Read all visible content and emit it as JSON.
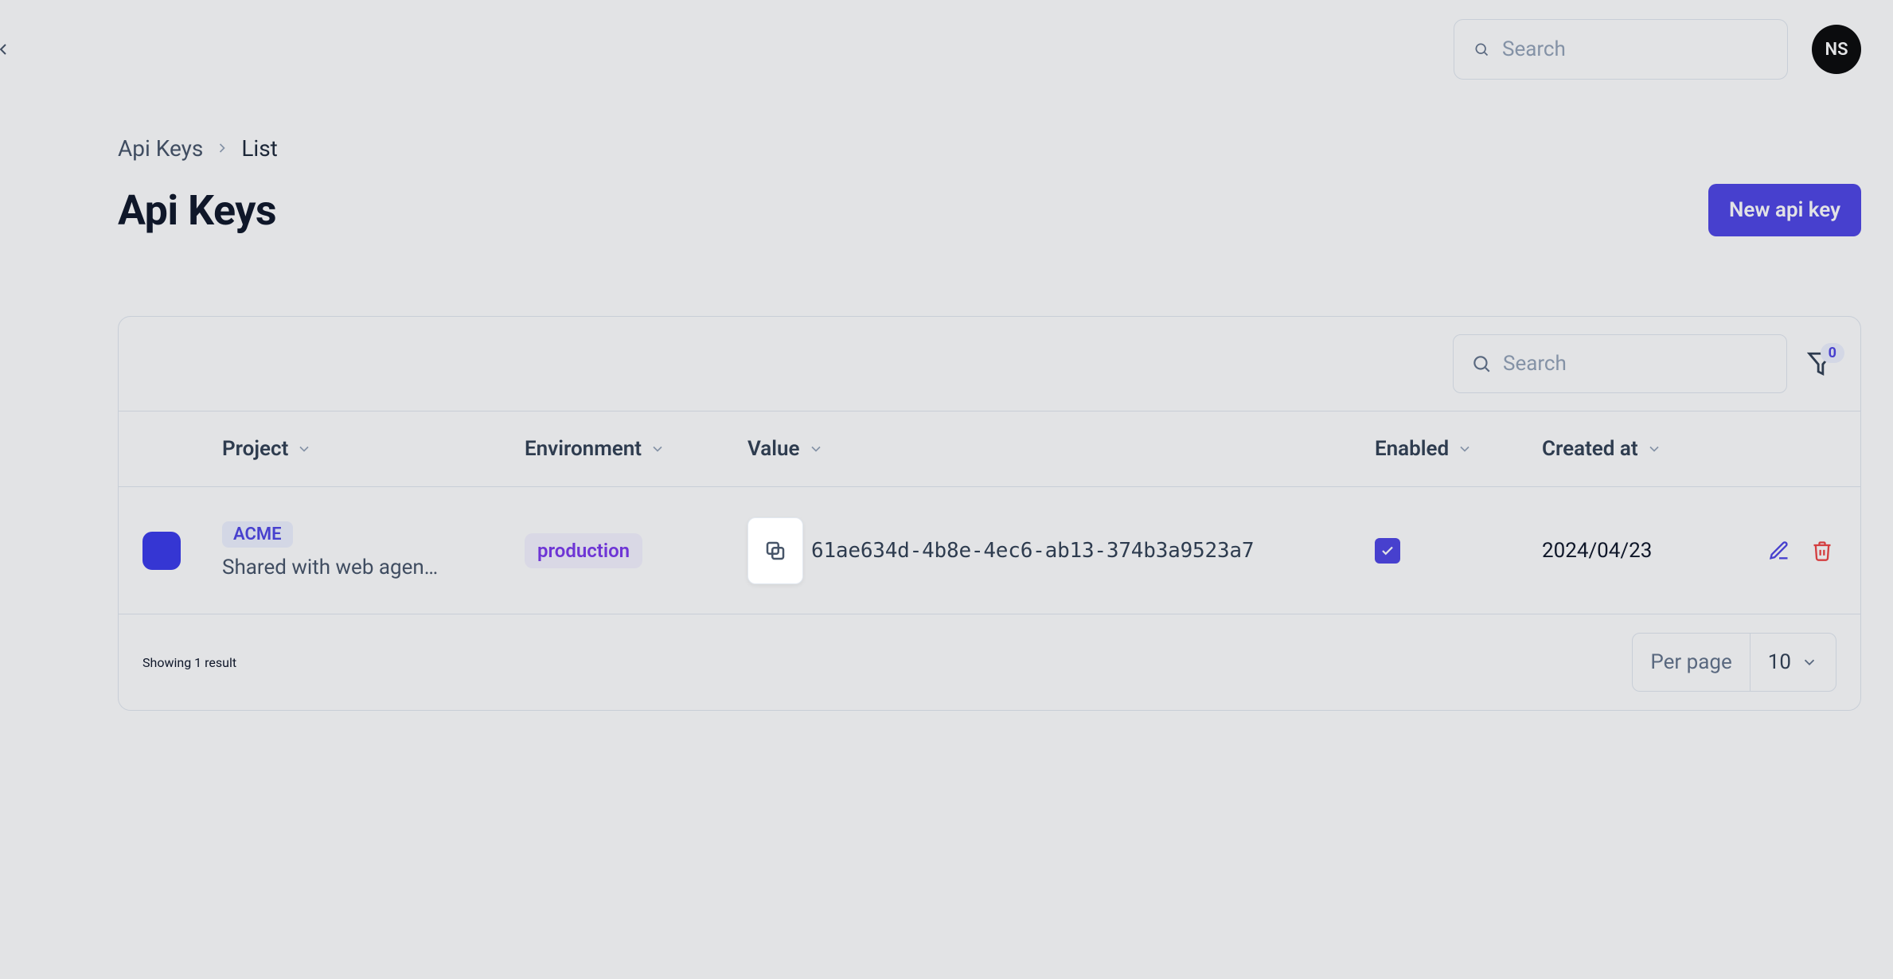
{
  "header": {
    "search_placeholder": "Search",
    "avatar_initials": "NS"
  },
  "breadcrumb": {
    "root": "Api Keys",
    "current": "List"
  },
  "page": {
    "title": "Api Keys",
    "new_button": "New api key"
  },
  "table": {
    "search_placeholder": "Search",
    "filter_count": "0",
    "columns": {
      "project": "Project",
      "environment": "Environment",
      "value": "Value",
      "enabled": "Enabled",
      "created_at": "Created at"
    },
    "rows": [
      {
        "project_name": "ACME",
        "project_subtitle": "Shared with web agen…",
        "environment": "production",
        "key_value": "61ae634d-4b8e-4ec6-ab13-374b3a9523a7",
        "enabled": true,
        "created_at": "2024/04/23"
      }
    ],
    "footer": {
      "status": "Showing 1 result",
      "per_page_label": "Per page",
      "per_page_value": "10"
    }
  }
}
